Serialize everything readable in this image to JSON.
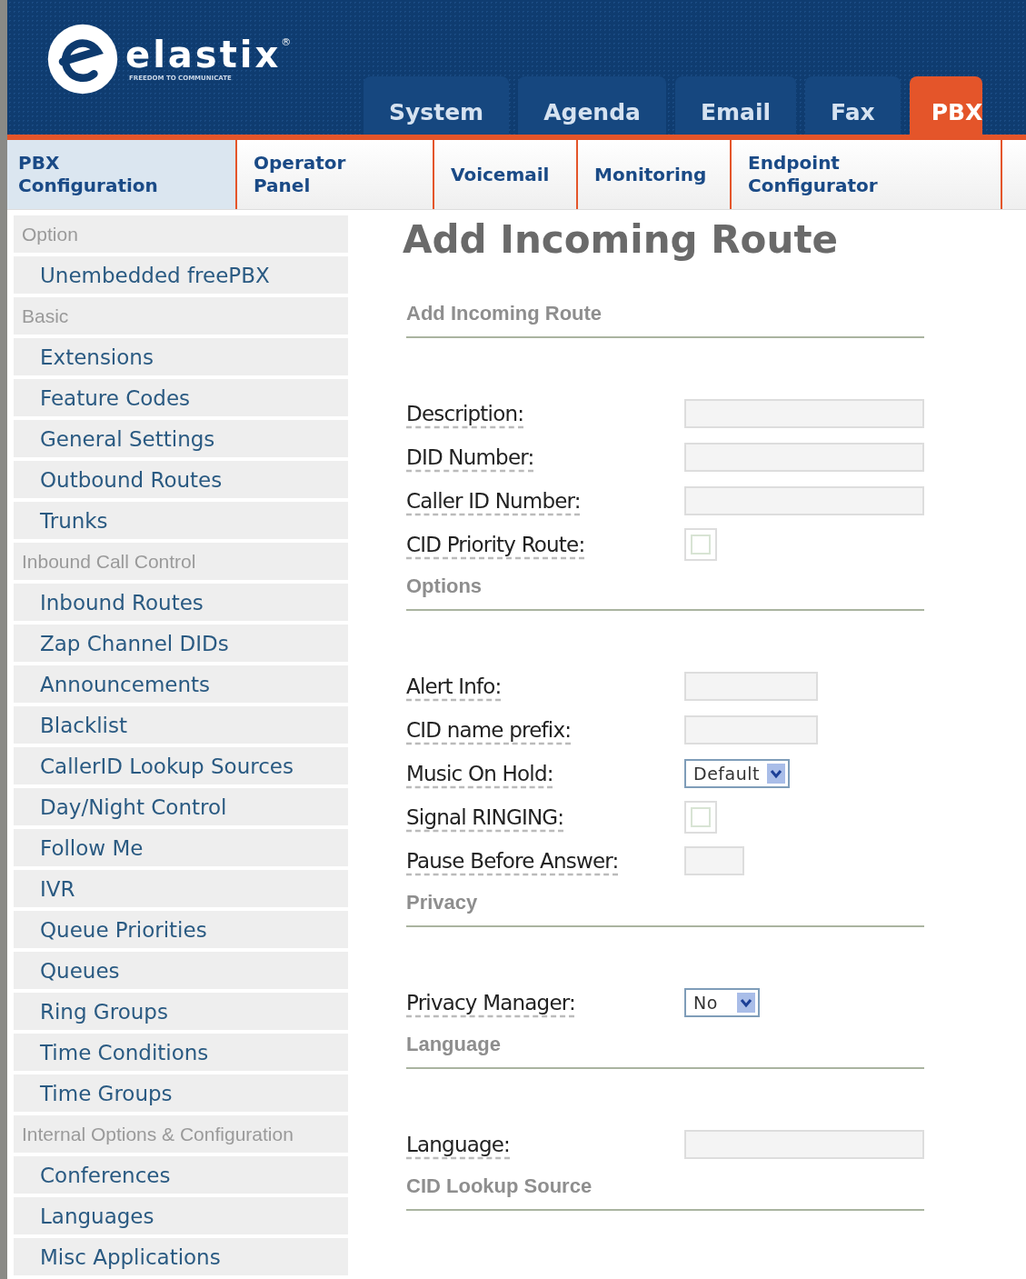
{
  "logo": {
    "name": "elastix",
    "mark": "®",
    "tagline": "FREEDOM TO COMMUNICATE"
  },
  "main_tabs": [
    {
      "label": "System",
      "selected": false
    },
    {
      "label": "Agenda",
      "selected": false
    },
    {
      "label": "Email",
      "selected": false
    },
    {
      "label": "Fax",
      "selected": false
    },
    {
      "label": "PBX",
      "selected": true
    }
  ],
  "sub_tabs": [
    {
      "label": "PBX Configuration",
      "selected": true
    },
    {
      "label": "Operator Panel",
      "selected": false
    },
    {
      "label": "Voicemail",
      "selected": false
    },
    {
      "label": "Monitoring",
      "selected": false
    },
    {
      "label": "Endpoint Configurator",
      "selected": false
    }
  ],
  "sidebar": {
    "items": [
      {
        "kind": "header",
        "label": "Option"
      },
      {
        "kind": "link",
        "label": "Unembedded freePBX"
      },
      {
        "kind": "header",
        "label": "Basic"
      },
      {
        "kind": "link",
        "label": "Extensions"
      },
      {
        "kind": "link",
        "label": "Feature Codes"
      },
      {
        "kind": "link",
        "label": "General Settings"
      },
      {
        "kind": "link",
        "label": "Outbound Routes"
      },
      {
        "kind": "link",
        "label": "Trunks"
      },
      {
        "kind": "header",
        "label": "Inbound Call Control"
      },
      {
        "kind": "link",
        "label": "Inbound Routes"
      },
      {
        "kind": "link",
        "label": "Zap Channel DIDs"
      },
      {
        "kind": "link",
        "label": "Announcements"
      },
      {
        "kind": "link",
        "label": "Blacklist"
      },
      {
        "kind": "link",
        "label": "CallerID Lookup Sources"
      },
      {
        "kind": "link",
        "label": "Day/Night Control"
      },
      {
        "kind": "link",
        "label": "Follow Me"
      },
      {
        "kind": "link",
        "label": "IVR"
      },
      {
        "kind": "link",
        "label": "Queue Priorities"
      },
      {
        "kind": "link",
        "label": "Queues"
      },
      {
        "kind": "link",
        "label": "Ring Groups"
      },
      {
        "kind": "link",
        "label": "Time Conditions"
      },
      {
        "kind": "link",
        "label": "Time Groups"
      },
      {
        "kind": "header",
        "label": "Internal Options & Configuration"
      },
      {
        "kind": "link",
        "label": "Conferences"
      },
      {
        "kind": "link",
        "label": "Languages"
      },
      {
        "kind": "link",
        "label": "Misc Applications"
      }
    ]
  },
  "page_title": "Add Incoming Route",
  "sections": [
    {
      "heading": "Add Incoming Route",
      "fields": [
        {
          "label": "Description:",
          "kind": "text"
        },
        {
          "label": "DID Number:",
          "kind": "text"
        },
        {
          "label": "Caller ID Number:",
          "kind": "text"
        },
        {
          "label": "CID Priority Route:",
          "kind": "checkbox",
          "checked": false
        }
      ]
    },
    {
      "heading": "Options",
      "fields": [
        {
          "label": "Alert Info:",
          "kind": "short-text"
        },
        {
          "label": "CID name prefix:",
          "kind": "short-text"
        },
        {
          "label": "Music On Hold:",
          "kind": "select",
          "value": "Default"
        },
        {
          "label": "Signal RINGING:",
          "kind": "checkbox",
          "checked": false
        },
        {
          "label": "Pause Before Answer:",
          "kind": "tiny-text"
        }
      ]
    },
    {
      "heading": "Privacy",
      "fields": [
        {
          "label": "Privacy Manager:",
          "kind": "select",
          "value": "No"
        }
      ]
    },
    {
      "heading": "Language",
      "fields": [
        {
          "label": "Language:",
          "kind": "text"
        }
      ]
    },
    {
      "heading": "CID Lookup Source"
    }
  ]
}
